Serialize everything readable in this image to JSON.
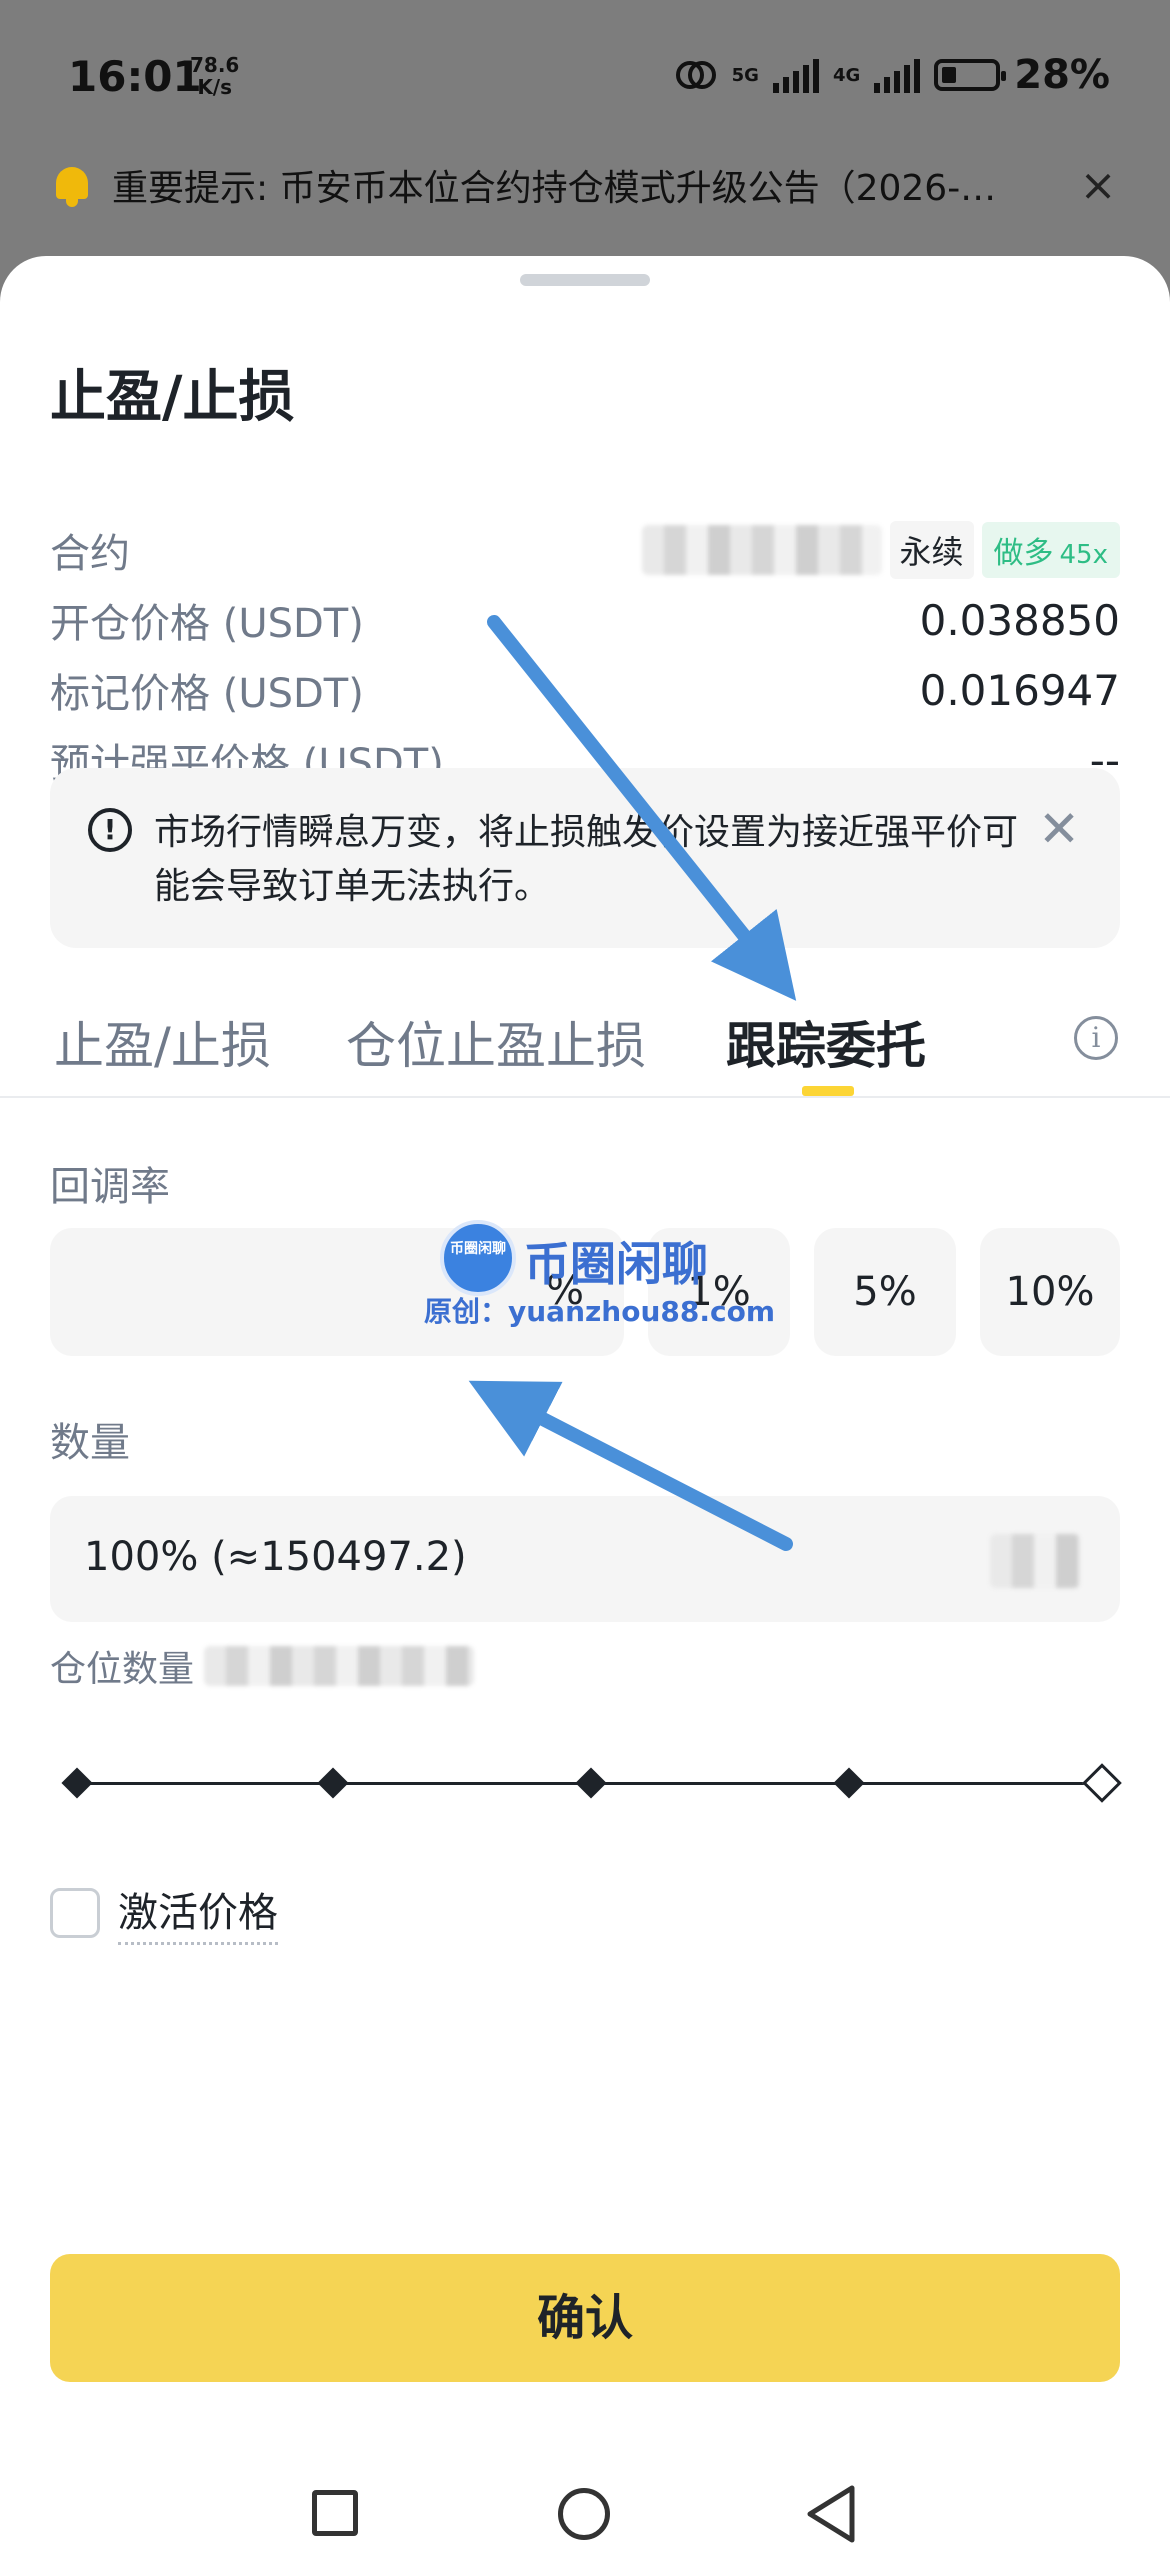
{
  "status_bar": {
    "time": "16:01",
    "net_speed_value": "78.6",
    "net_speed_unit": "K/s",
    "network_label_1": "5G",
    "network_label_2": "4G",
    "battery": "28%"
  },
  "notice": {
    "text": "重要提示: 币安币本位合约持仓模式升级公告（2026-…",
    "close": "×"
  },
  "sheet": {
    "title": "止盈/止损",
    "info": {
      "contract_label": "合约",
      "contract_suffix": "永续",
      "direction": "做多",
      "leverage": "45x",
      "entry_label": "开仓价格 (USDT)",
      "entry_value": "0.038850",
      "mark_label": "标记价格 (USDT)",
      "mark_value": "0.016947",
      "liq_label": "预计强平价格 (USDT)",
      "liq_value": "--"
    },
    "warning": {
      "icon": "!",
      "text": "市场行情瞬息万变，将止损触发价设置为接近强平价可能会导致订单无法执行。",
      "close": "✕"
    },
    "tabs": [
      {
        "label": "止盈/止损",
        "active": false
      },
      {
        "label": "仓位止盈止损",
        "active": false
      },
      {
        "label": "跟踪委托",
        "active": true
      }
    ],
    "tab_info_icon": "i",
    "callback": {
      "label": "回调率",
      "input_value": "",
      "unit": "%",
      "chips": [
        "1%",
        "5%",
        "10%"
      ]
    },
    "quantity": {
      "label": "数量",
      "value": "100% (≈150497.2)",
      "position_qty_label": "仓位数量"
    },
    "slider": {
      "value_percent": 100,
      "stops": [
        0,
        25,
        50,
        75,
        100
      ]
    },
    "activation": {
      "label": "激活价格",
      "checked": false
    },
    "confirm_label": "确认"
  },
  "watermark": {
    "logo_text": "币圈闲聊",
    "brand": "币圈闲聊",
    "url": "原创：yuanzhou88.com"
  },
  "colors": {
    "accent": "#fcd535",
    "confirm_bg": "#f5d454",
    "long_green": "#2ebd85",
    "annotation_arrow": "#4a90d9"
  }
}
